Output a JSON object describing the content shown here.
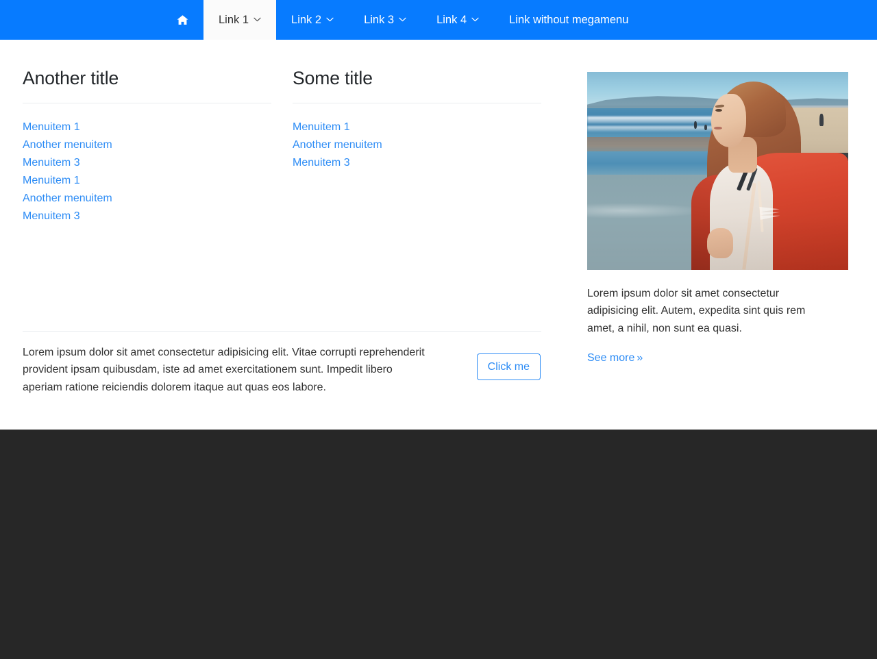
{
  "theme": {
    "brand_blue": "#077bff",
    "link_blue": "#2d8cf5",
    "text_dark": "#323232",
    "heading_dark": "#212529",
    "rule_gray": "#e9ecef",
    "footer_dark": "#272727",
    "active_tab_bg": "#fbfbfb"
  },
  "navbar": {
    "home_icon": "home-icon",
    "items": [
      {
        "label": "Link 1",
        "has_caret": true,
        "active": true
      },
      {
        "label": "Link 2",
        "has_caret": true,
        "active": false
      },
      {
        "label": "Link 3",
        "has_caret": true,
        "active": false
      },
      {
        "label": "Link 4",
        "has_caret": true,
        "active": false
      },
      {
        "label": "Link without megamenu",
        "has_caret": false,
        "active": false
      }
    ]
  },
  "megamenu": {
    "column_a": {
      "title": "Another title",
      "items": [
        "Menuitem 1",
        "Another menuitem",
        "Menuitem 3",
        "Menuitem 1",
        "Another menuitem",
        "Menuitem 3"
      ]
    },
    "column_b": {
      "title": "Some title",
      "items": [
        "Menuitem 1",
        "Another menuitem",
        "Menuitem 3"
      ]
    },
    "column_c": {
      "image_alt": "woman in red hoodie standing on beach looking at the ocean",
      "caption": "Lorem ipsum dolor sit amet consectetur adipisicing elit. Autem, expedita sint quis rem amet, a nihil, non sunt ea quasi.",
      "see_more_label": "See more",
      "see_more_chevron": "»"
    },
    "bottom": {
      "text": "Lorem ipsum dolor sit amet consectetur adipisicing elit. Vitae corrupti reprehenderit provident ipsam quibusdam, iste ad amet exercitationem sunt. Impedit libero aperiam ratione reiciendis dolorem itaque aut quas eos labore.",
      "button_label": "Click me"
    }
  }
}
